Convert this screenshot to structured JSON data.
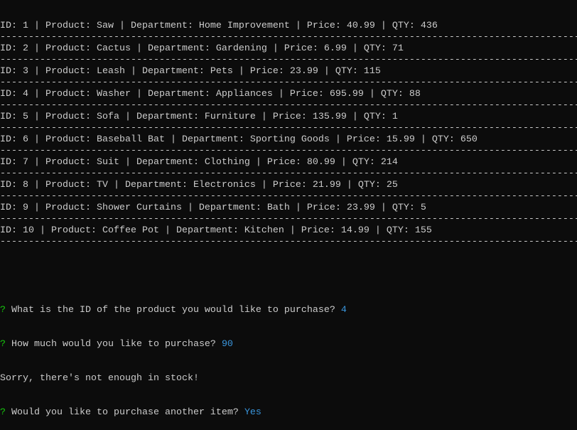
{
  "colors": {
    "background": "#0c0c0c",
    "text": "#cccccc",
    "prompt_mark": "#16c60c",
    "answer": "#3a96dd"
  },
  "separator": "----------------------------------------------------------------------------------------------------------",
  "products": [
    "ID: 1 | Product: Saw | Department: Home Improvement | Price: 40.99 | QTY: 436",
    "ID: 2 | Product: Cactus | Department: Gardening | Price: 6.99 | QTY: 71",
    "ID: 3 | Product: Leash | Department: Pets | Price: 23.99 | QTY: 115",
    "ID: 4 | Product: Washer | Department: Appliances | Price: 695.99 | QTY: 88",
    "ID: 5 | Product: Sofa | Department: Furniture | Price: 135.99 | QTY: 1",
    "ID: 6 | Product: Baseball Bat | Department: Sporting Goods | Price: 15.99 | QTY: 650",
    "ID: 7 | Product: Suit | Department: Clothing | Price: 80.99 | QTY: 214",
    "ID: 8 | Product: TV | Department: Electronics | Price: 21.99 | QTY: 25",
    "ID: 9 | Product: Shower Curtains | Department: Bath | Price: 23.99 | QTY: 5",
    "ID: 10 | Product: Coffee Pot | Department: Kitchen | Price: 14.99 | QTY: 155"
  ],
  "prompts": [
    {
      "mark": "?",
      "question": " What is the ID of the product you would like to purchase? ",
      "answer": "4"
    },
    {
      "mark": "?",
      "question": " How much would you like to purchase? ",
      "answer": "90"
    }
  ],
  "message": "Sorry, there's not enough in stock!",
  "prompt_again": {
    "mark": "?",
    "question": " Would you like to purchase another item? ",
    "answer": "Yes"
  }
}
